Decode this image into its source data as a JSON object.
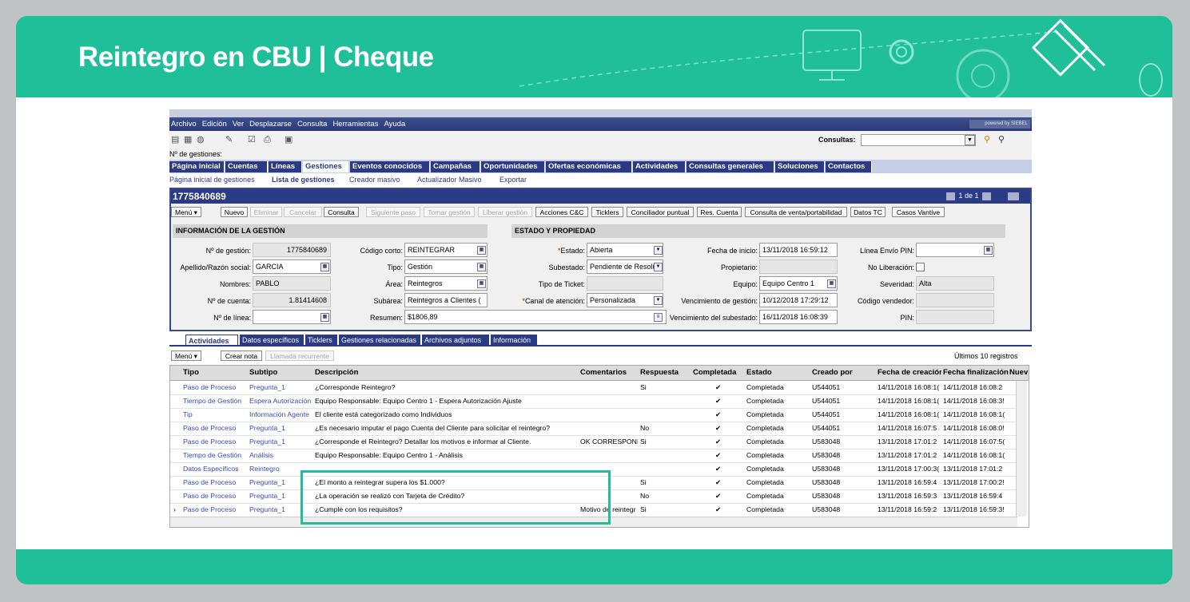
{
  "slide": {
    "title": "Reintegro en CBU | Cheque"
  },
  "menu": [
    "Archivo",
    "Edición",
    "Ver",
    "Desplazarse",
    "Consulta",
    "Herramientas",
    "Ayuda"
  ],
  "siebel_logo": "powered by SIEBEL",
  "toolbar": {
    "consultas_label": "Consultas:"
  },
  "n_gestiones_label": "Nº de gestiones:",
  "tabs": [
    "Página inicial",
    "Cuentas",
    "Líneas",
    "Gestiones",
    "Eventos conocidos",
    "Campañas",
    "Oportunidades",
    "Ofertas económicas",
    "Actividades",
    "Consultas generales",
    "Soluciones",
    "Contactos"
  ],
  "active_tab": "Gestiones",
  "subnav": [
    "Página inicial de gestiones",
    "Lista de gestiones",
    "Creador masivo",
    "Actualizador Masivo",
    "Exportar"
  ],
  "record": {
    "id": "1775840689",
    "pager": "1 de 1",
    "buttons": [
      "Menú ▾",
      "Nuevo",
      "Eliminar",
      "Cancelar",
      "Consulta",
      "Siguiente paso",
      "Tomar gestión",
      "Liberar gestión",
      "Acciones C&C",
      "Ticklers",
      "Conciliador puntual",
      "Res. Cuenta",
      "Consulta de venta/portabilidad",
      "Datos TC",
      "Casos Vantive"
    ],
    "section_info": "INFORMACIÓN DE LA GESTIÓN",
    "section_estado": "ESTADO Y PROPIEDAD"
  },
  "fields": {
    "n_gestion": {
      "label": "Nº de gestión:",
      "value": "1775840689"
    },
    "apellido": {
      "label": "Apellido/Razón social:",
      "value": "GARCIA"
    },
    "nombres": {
      "label": "Nombres:",
      "value": "PABLO"
    },
    "n_cuenta": {
      "label": "Nº de cuenta:",
      "value": "1.81414608"
    },
    "n_linea": {
      "label": "Nº de línea:",
      "value": ""
    },
    "codigo_corto": {
      "label": "Código corto:",
      "value": "REINTEGRAR"
    },
    "tipo": {
      "label": "Tipo:",
      "value": "Gestión"
    },
    "area": {
      "label": "Área:",
      "value": "Reintegros"
    },
    "subarea": {
      "label": "Subárea:",
      "value": "Reintegros a Clientes ("
    },
    "resumen": {
      "label": "Resumen:",
      "value": "$1806,89"
    },
    "estado": {
      "label": "Estado:",
      "value": "Abierta"
    },
    "subestado": {
      "label": "Subestado:",
      "value": "Pendiente de Resolu"
    },
    "tipo_ticket": {
      "label": "Tipo de Ticket:",
      "value": ""
    },
    "canal": {
      "label": "Canal de atención:",
      "value": "Personalizada"
    },
    "fecha_inicio": {
      "label": "Fecha de inicio:",
      "value": "13/11/2018 16:59:12"
    },
    "propietario": {
      "label": "Propietario:",
      "value": ""
    },
    "equipo": {
      "label": "Equipo:",
      "value": "Equipo Centro 1"
    },
    "venc_gestion": {
      "label": "Vencimiento de gestión:",
      "value": "10/12/2018 17:29:12"
    },
    "venc_subestado": {
      "label": "Vencimiento del subestado:",
      "value": "16/11/2018 16:08:39"
    },
    "linea_envio": {
      "label": "Línea Envío PIN:",
      "value": ""
    },
    "no_liberacion": {
      "label": "No Liberación:",
      "value": ""
    },
    "severidad": {
      "label": "Severidad:",
      "value": "Alta"
    },
    "codigo_vendedor": {
      "label": "Código vendedor:",
      "value": ""
    },
    "pin": {
      "label": "PIN:",
      "value": ""
    }
  },
  "lower_tabs": [
    "Actividades",
    "Datos específicos",
    "Ticklers",
    "Gestiones relacionadas",
    "Archivos adjuntos",
    "Información"
  ],
  "list": {
    "menu_label": "Menú ▾",
    "crear_nota": "Crear nota",
    "llamada": "Llamada recurrente",
    "ultimos": "Últimos 10 registros",
    "columns": [
      "Tipo",
      "Subtipo",
      "Descripción",
      "Comentarios",
      "Respuesta",
      "Completada",
      "Estado",
      "Creado por",
      "Fecha de creación",
      "Fecha finalización",
      "Nuev"
    ],
    "rows": [
      {
        "tipo": "Paso de Proceso",
        "subtipo": "Pregunta_1",
        "desc": "¿Corresponde Reintegro?",
        "coment": "",
        "resp": "Si",
        "comp": "✔",
        "estado": "Completada",
        "creado": "U544051",
        "fcrea": "14/11/2018 16:08:1(",
        "ffin": "14/11/2018 16:08:2"
      },
      {
        "tipo": "Tiempo de Gestión",
        "subtipo": "Espera Autorización",
        "desc": "Equipo Responsable: Equipo Centro 1 - Espera Autorización Ajuste",
        "coment": "",
        "resp": "",
        "comp": "✔",
        "estado": "Completada",
        "creado": "U544051",
        "fcrea": "14/11/2018 16:08:1(",
        "ffin": "14/11/2018 16:08:3!"
      },
      {
        "tipo": "Tip",
        "subtipo": "Información Agente",
        "desc": "El cliente está categorizado como Individuos",
        "coment": "",
        "resp": "",
        "comp": "✔",
        "estado": "Completada",
        "creado": "U544051",
        "fcrea": "14/11/2018 16:08:1(",
        "ffin": "14/11/2018 16:08:1("
      },
      {
        "tipo": "Paso de Proceso",
        "subtipo": "Pregunta_1",
        "desc": "¿Es necesario imputar el pago Cuenta del Cliente para solicitar el reintegro?",
        "coment": "",
        "resp": "No",
        "comp": "✔",
        "estado": "Completada",
        "creado": "U544051",
        "fcrea": "14/11/2018 16:07:5",
        "ffin": "14/11/2018 16:08:0!"
      },
      {
        "tipo": "Paso de Proceso",
        "subtipo": "Pregunta_1",
        "desc": "¿Corresponde el Reintegro?  Detallar los motivos e informar al Cliente.",
        "coment": "OK CORRESPOND",
        "resp": "Si",
        "comp": "✔",
        "estado": "Completada",
        "creado": "U583048",
        "fcrea": "13/11/2018 17:01:2",
        "ffin": "14/11/2018 16:07:5("
      },
      {
        "tipo": "Tiempo de Gestión",
        "subtipo": "Análisis",
        "desc": "Equipo Responsable: Equipo Centro 1 - Análisis",
        "coment": "",
        "resp": "",
        "comp": "✔",
        "estado": "Completada",
        "creado": "U583048",
        "fcrea": "13/11/2018 17:01:2",
        "ffin": "14/11/2018 16:08:1("
      },
      {
        "tipo": "Datos Específicos",
        "subtipo": "Reintegro",
        "desc": "",
        "coment": "",
        "resp": "",
        "comp": "✔",
        "estado": "Completada",
        "creado": "U583048",
        "fcrea": "13/11/2018 17:00:3(",
        "ffin": "13/11/2018 17:01:2"
      },
      {
        "tipo": "Paso de Proceso",
        "subtipo": "Pregunta_1",
        "desc": "¿El monto a reintegrar supera los $1.000?",
        "coment": "",
        "resp": "Si",
        "comp": "✔",
        "estado": "Completada",
        "creado": "U583048",
        "fcrea": "13/11/2018 16:59:4",
        "ffin": "13/11/2018 17:00:2!"
      },
      {
        "tipo": "Paso de Proceso",
        "subtipo": "Pregunta_1",
        "desc": "¿La operación se realizó con Tarjeta de Crédito?",
        "coment": "",
        "resp": "No",
        "comp": "✔",
        "estado": "Completada",
        "creado": "U583048",
        "fcrea": "13/11/2018 16:59:3",
        "ffin": "13/11/2018 16:59:4"
      },
      {
        "tipo": "Paso de Proceso",
        "subtipo": "Pregunta_1",
        "desc": "¿Cumple con los requisitos?",
        "coment": "Motivo de reintegr",
        "resp": "Si",
        "comp": "✔",
        "estado": "Completada",
        "creado": "U583048",
        "fcrea": "13/11/2018 16:59:2",
        "ffin": "13/11/2018 16:59:3!"
      }
    ]
  },
  "colors": {
    "accent": "#1fbf9a",
    "siebel_blue": "#2a3a84"
  }
}
